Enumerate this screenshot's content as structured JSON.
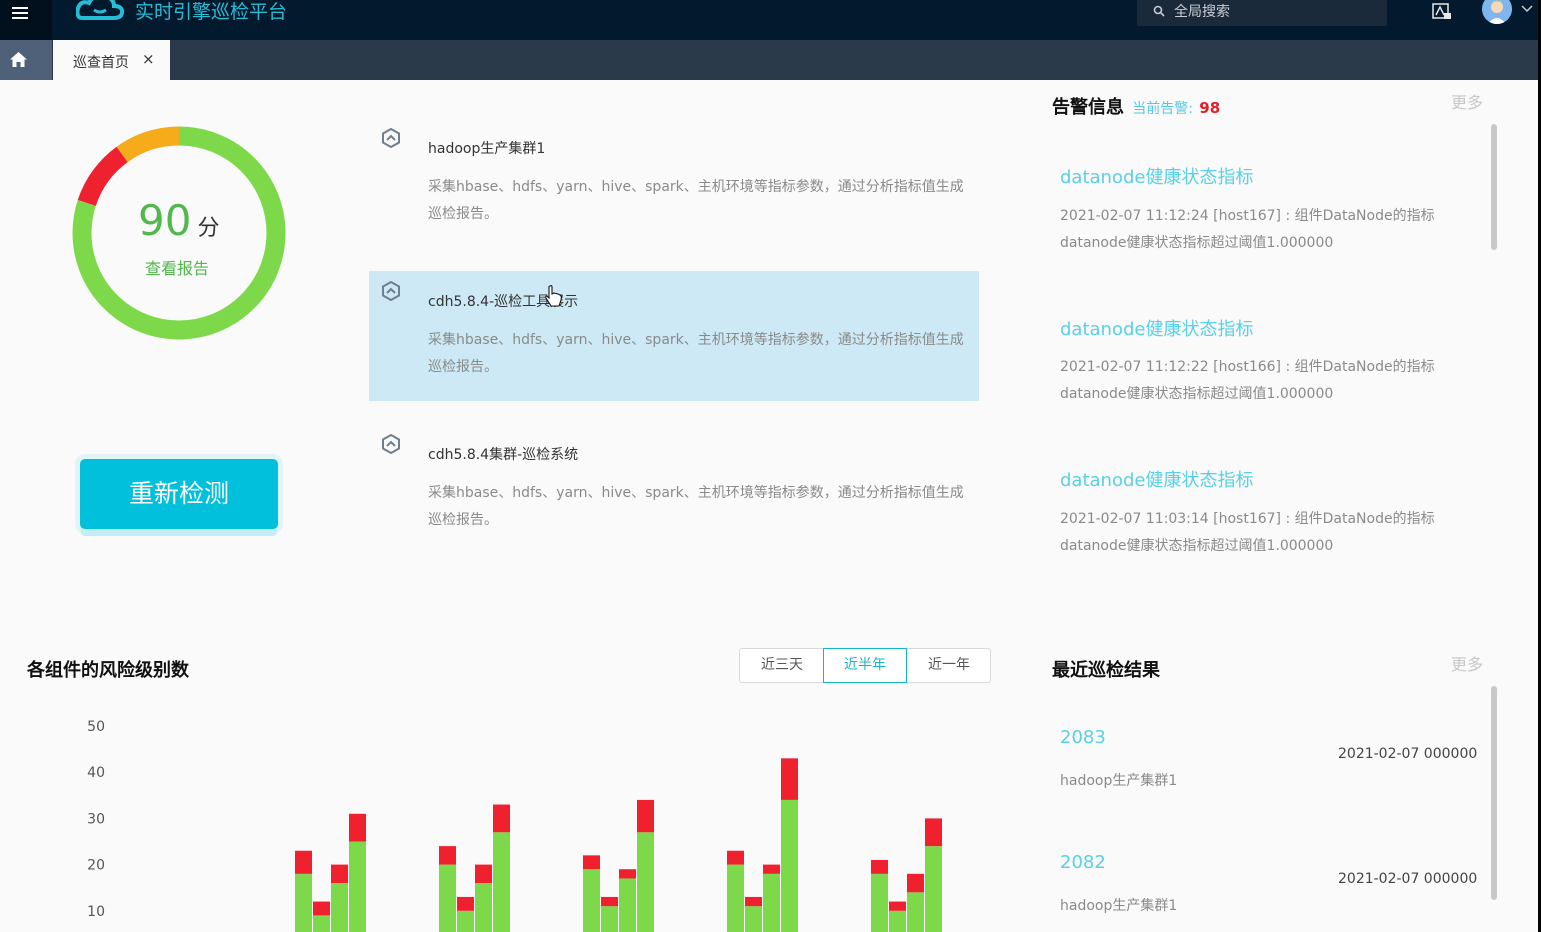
{
  "app": {
    "title": "实时引擎巡检平台"
  },
  "header": {
    "search_placeholder": "全局搜索"
  },
  "tabs": [
    {
      "label": "巡查首页",
      "close": "×"
    }
  ],
  "score": {
    "value": "90",
    "unit": "分",
    "link": "查看报告",
    "ring_segments": {
      "green": 0.8,
      "red": 0.1,
      "orange": 0.1
    }
  },
  "recheck_label": "重新检测",
  "clusters": [
    {
      "title": "hadoop生产集群1",
      "desc": "采集hbase、hdfs、yarn、hive、spark、主机环境等指标参数，通过分析指标值生成巡检报告。"
    },
    {
      "title": "cdh5.8.4-巡检工具展示",
      "desc": "采集hbase、hdfs、yarn、hive、spark、主机环境等指标参数，通过分析指标值生成巡检报告。"
    },
    {
      "title": "cdh5.8.4集群-巡检系统",
      "desc": "采集hbase、hdfs、yarn、hive、spark、主机环境等指标参数，通过分析指标值生成巡检报告。"
    }
  ],
  "alerts": {
    "title": "告警信息",
    "current_label": "当前告警:",
    "current_count": "98",
    "more": "更多",
    "items": [
      {
        "title": "datanode健康状态指标",
        "body": "2021-02-07 11:12:24 [host167] : 组件DataNode的指标datanode健康状态指标超过阈值1.000000"
      },
      {
        "title": "datanode健康状态指标",
        "body": "2021-02-07 11:12:22 [host166] : 组件DataNode的指标datanode健康状态指标超过阈值1.000000"
      },
      {
        "title": "datanode健康状态指标",
        "body": "2021-02-07 11:03:14 [host167] : 组件DataNode的指标datanode健康状态指标超过阈值1.000000"
      }
    ]
  },
  "risk": {
    "title": "各组件的风险级别数",
    "ranges": [
      "近三天",
      "近半年",
      "近一年"
    ],
    "active_range": "近半年"
  },
  "chart_data": {
    "type": "bar",
    "stacked": true,
    "ylim": [
      0,
      50
    ],
    "yticks": [
      "50",
      "40",
      "30",
      "20",
      "10"
    ],
    "groups": [
      {
        "bars": [
          {
            "green": 18,
            "red": 5
          },
          {
            "green": 9,
            "red": 3
          },
          {
            "green": 16,
            "red": 4
          },
          {
            "green": 25,
            "red": 6
          }
        ]
      },
      {
        "bars": [
          {
            "green": 20,
            "red": 4
          },
          {
            "green": 10,
            "red": 3
          },
          {
            "green": 16,
            "red": 4
          },
          {
            "green": 27,
            "red": 6
          }
        ]
      },
      {
        "bars": [
          {
            "green": 19,
            "red": 3
          },
          {
            "green": 11,
            "red": 2
          },
          {
            "green": 17,
            "red": 2
          },
          {
            "green": 27,
            "red": 7
          }
        ]
      },
      {
        "bars": [
          {
            "green": 20,
            "red": 3
          },
          {
            "green": 11,
            "red": 2
          },
          {
            "green": 18,
            "red": 2
          },
          {
            "green": 34,
            "red": 9
          }
        ]
      },
      {
        "bars": [
          {
            "green": 18,
            "red": 3
          },
          {
            "green": 10,
            "red": 2
          },
          {
            "green": 14,
            "red": 4
          },
          {
            "green": 24,
            "red": 6
          }
        ]
      }
    ],
    "colors": {
      "green": "#7ed94a",
      "red": "#f0212e"
    }
  },
  "results": {
    "title": "最近巡检结果",
    "more": "更多",
    "items": [
      {
        "id": "2083",
        "date": "2021-02-07 000000",
        "name": "hadoop生产集群1"
      },
      {
        "id": "2082",
        "date": "2021-02-07 000000",
        "name": "hadoop生产集群1"
      }
    ]
  }
}
